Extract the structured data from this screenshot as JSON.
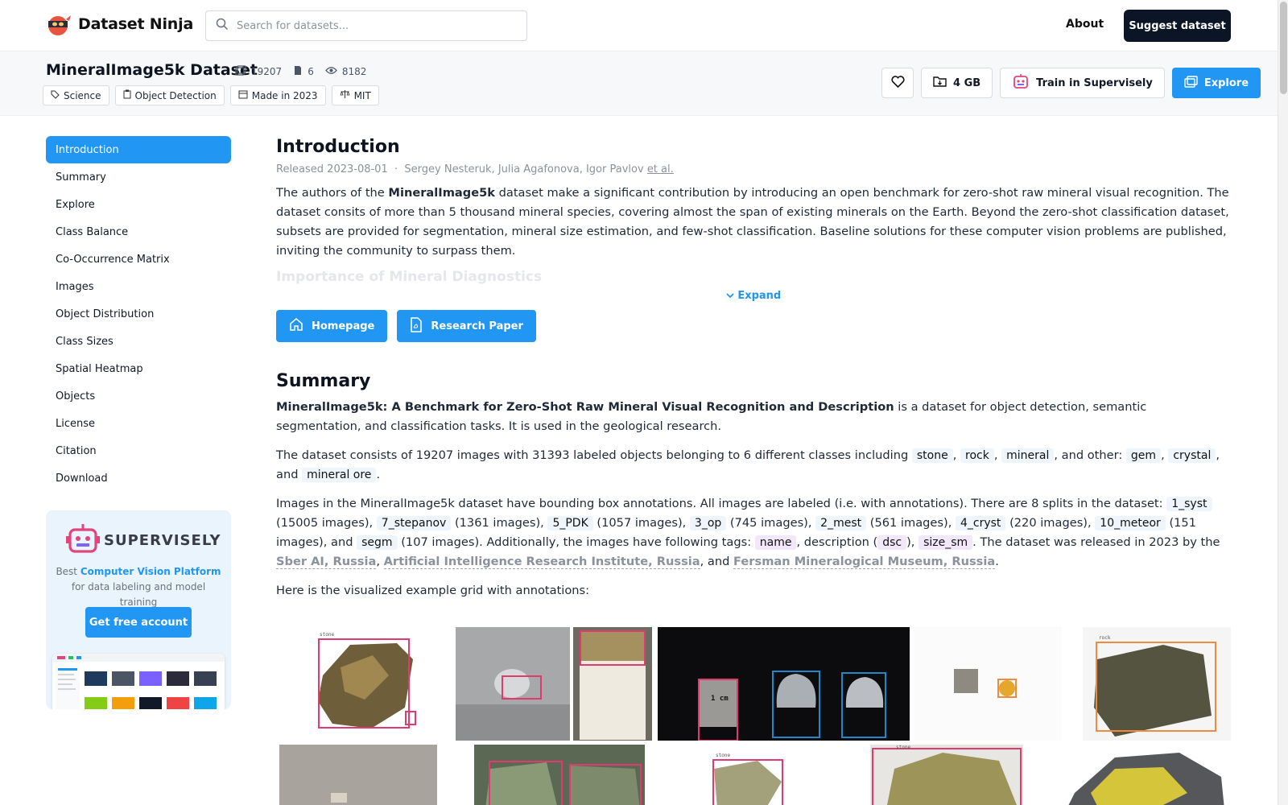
{
  "header": {
    "brand": "Dataset Ninja",
    "search_placeholder": "Search for datasets...",
    "about": "About",
    "suggest": "Suggest dataset"
  },
  "dataset": {
    "title": "MineralImage5k Dataset",
    "images": "19207",
    "classes": "6",
    "views": "8182",
    "tags": [
      "Science",
      "Object Detection",
      "Made in 2023",
      "MIT"
    ],
    "size": "4 GB",
    "train": "Train in Supervisely",
    "explore": "Explore"
  },
  "nav": {
    "items": [
      "Introduction",
      "Summary",
      "Explore",
      "Class Balance",
      "Co-Occurrence Matrix",
      "Images",
      "Object Distribution",
      "Class Sizes",
      "Spatial Heatmap",
      "Objects",
      "License",
      "Citation",
      "Download"
    ],
    "active": "Introduction"
  },
  "promo": {
    "brand": "SUPERVISELY",
    "text_pre": "Best",
    "text_link": "Computer Vision Platform",
    "text_post": "for data labeling and model training",
    "button": "Get free account"
  },
  "intro": {
    "heading": "Introduction",
    "released": "Released 2023-08-01",
    "sep": "·",
    "authors": "Sergey Nesteruk, Julia Agafonova, Igor Pavlov",
    "etal": "et al.",
    "p_pre": "The authors of the",
    "p_bold": "MineralImage5k",
    "p_post": "dataset make a significant contribution by introducing an open benchmark for zero-shot raw mineral visual recognition. The dataset consits of more than 5 thousand mineral species, covering almost the span of existing minerals on the Earth. Beyond the zero-shot classification dataset, subsets are provided for segmentation, mineral size estimation, and few-shot classification. Baseline solutions for these computer vision problems are published, inviting the community to surpass them.",
    "faded": "Importance of Mineral Diagnostics",
    "expand": "Expand",
    "homepage": "Homepage",
    "paper": "Research Paper"
  },
  "summary": {
    "heading": "Summary",
    "p1_bold": "MineralImage5k: A Benchmark for Zero-Shot Raw Mineral Visual Recognition and Description",
    "p1_post": "is a dataset for object detection, semantic segmentation, and classification tasks. It is used in the geological research.",
    "p2_pre": "The dataset consists of 19207 images with 31393 labeled objects belonging to 6 different classes including",
    "classes_main": [
      "stone",
      "rock",
      "mineral"
    ],
    "p2_mid": ", and other:",
    "classes_other": [
      "gem",
      "crystal"
    ],
    "class_last": "mineral ore",
    "p3_pre": "Images in the MineralImage5k dataset have bounding box annotations. All images are labeled (i.e. with annotations). There are 8 splits in the dataset:",
    "splits": [
      {
        "name": "1_syst",
        "count": "(15005 images)"
      },
      {
        "name": "7_stepanov",
        "count": "(1361 images)"
      },
      {
        "name": "5_PDK",
        "count": "(1057 images)"
      },
      {
        "name": "3_op",
        "count": "(745 images)"
      },
      {
        "name": "2_mest",
        "count": "(561 images)"
      },
      {
        "name": "4_cryst",
        "count": "(220 images)"
      },
      {
        "name": "10_meteor",
        "count": "(151 images)"
      },
      {
        "name": "segm",
        "count": "(107 images)"
      }
    ],
    "p3_tags_pre": ". Additionally, the images have following tags:",
    "tags": [
      "name",
      "dsc",
      "size_sm"
    ],
    "p3_release": ". The dataset was released in 2023 by the",
    "orgs": [
      "Sber AI, Russia",
      "Artificial Intelligence Research Institute, Russia",
      "Fersman Mineralogical Museum, Russia"
    ],
    "p4": "Here is the visualized example grid with annotations:"
  },
  "grid": {
    "labels": [
      "stone",
      "stone",
      "rock",
      "1 cm",
      "stone",
      "stone"
    ]
  },
  "colors": {
    "accent": "#2196f3",
    "dark": "#0b1526",
    "bbox_pink": "#e03a6e",
    "bbox_blue": "#1e88c8",
    "bbox_orange": "#f08a3e"
  }
}
